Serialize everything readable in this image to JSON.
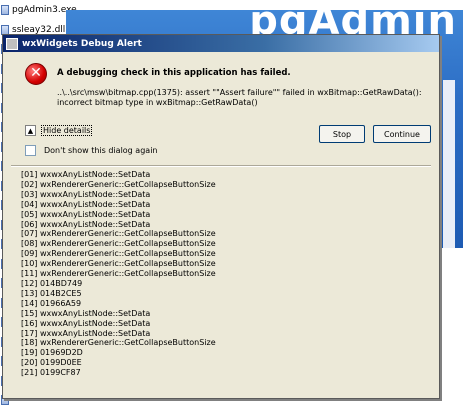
{
  "background_files": [
    {
      "name": "pgAdmin3.exe",
      "icon": "executable-icon"
    },
    {
      "name": "ssleay32.dll",
      "icon": "dll-file-icon"
    },
    {
      "name": "",
      "icon": "file-icon"
    },
    {
      "name": "",
      "icon": "file-icon"
    },
    {
      "name": "",
      "icon": "file-icon"
    },
    {
      "name": "",
      "icon": "file-icon"
    },
    {
      "name": "",
      "icon": "file-icon"
    },
    {
      "name": "",
      "icon": "file-icon"
    },
    {
      "name": "",
      "icon": "file-icon"
    },
    {
      "name": "",
      "icon": "file-icon"
    },
    {
      "name": "",
      "icon": "file-icon"
    },
    {
      "name": "",
      "icon": "file-icon"
    },
    {
      "name": "",
      "icon": "file-icon"
    },
    {
      "name": "",
      "icon": "file-icon"
    },
    {
      "name": "",
      "icon": "file-icon"
    },
    {
      "name": "",
      "icon": "file-icon"
    },
    {
      "name": "",
      "icon": "file-icon"
    },
    {
      "name": "",
      "icon": "file-icon"
    },
    {
      "name": "",
      "icon": "file-icon"
    },
    {
      "name": "",
      "icon": "file-icon"
    },
    {
      "name": "",
      "icon": "file-icon"
    }
  ],
  "splash": {
    "title": "pgAdmin",
    "color": "#2b6cc4"
  },
  "dialog": {
    "title": "wxWidgets Debug Alert",
    "icon": "error-icon",
    "message_title": "A debugging check in this application has failed.",
    "message_detail": "..\\..\\src\\msw\\bitmap.cpp(1375): assert \"\"Assert failure\"\" failed in wxBitmap::GetRawData(): incorrect bitmap type in wxBitmap::GetRawData()",
    "hide_details_label": "Hide details",
    "hide_details_icon": "triangle-up-icon",
    "dont_show_label": "Don't show this dialog again",
    "dont_show_checked": false,
    "stop_label": "Stop",
    "continue_label": "Continue",
    "stack_trace": [
      "[01] wxwxAnyListNode::SetData",
      "[02] wxRendererGeneric::GetCollapseButtonSize",
      "[03] wxwxAnyListNode::SetData",
      "[04] wxwxAnyListNode::SetData",
      "[05] wxwxAnyListNode::SetData",
      "[06] wxwxAnyListNode::SetData",
      "[07] wxRendererGeneric::GetCollapseButtonSize",
      "[08] wxRendererGeneric::GetCollapseButtonSize",
      "[09] wxRendererGeneric::GetCollapseButtonSize",
      "[10] wxRendererGeneric::GetCollapseButtonSize",
      "[11] wxRendererGeneric::GetCollapseButtonSize",
      "[12] 014BD749",
      "[13] 014B2CE5",
      "[14] 01966A59",
      "[15] wxwxAnyListNode::SetData",
      "[16] wxwxAnyListNode::SetData",
      "[17] wxwxAnyListNode::SetData",
      "[18] wxRendererGeneric::GetCollapseButtonSize",
      "[19] 01969D2D",
      "[20] 0199D0EE",
      "[21] 0199CF87"
    ]
  },
  "colors": {
    "titlebar": "#0a246a",
    "dialog_bg": "#ece9d8",
    "error_red": "#d40000"
  }
}
